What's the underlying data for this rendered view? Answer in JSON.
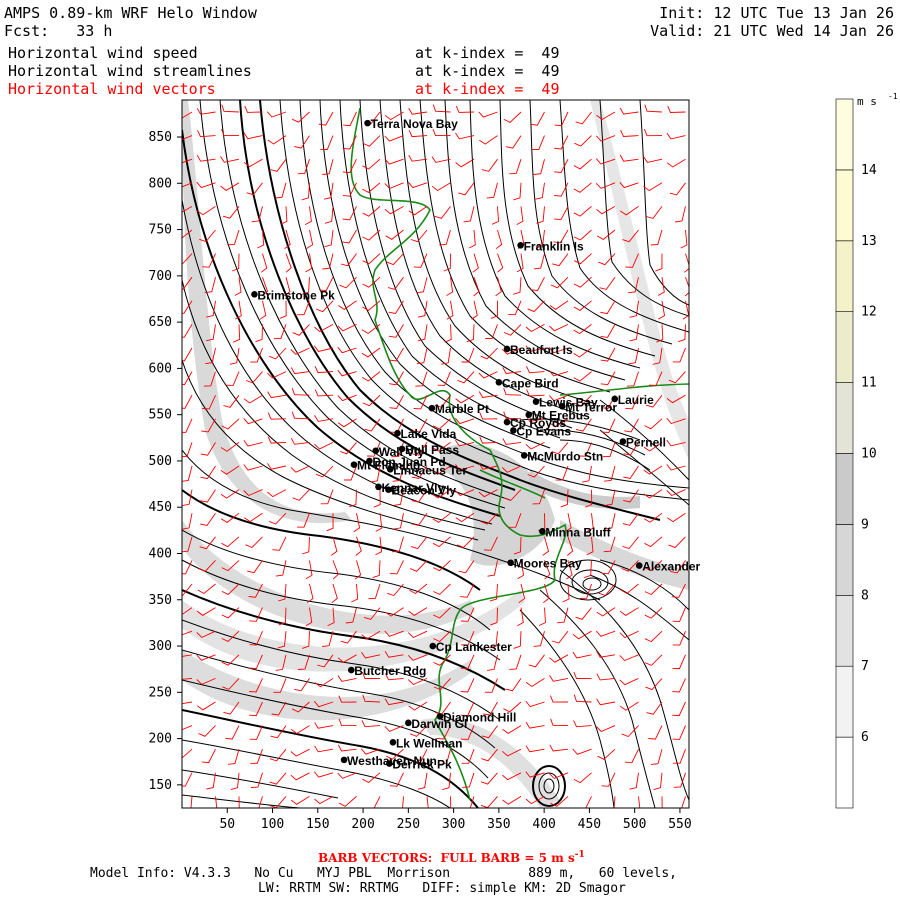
{
  "header": {
    "title": "AMPS 0.89-km WRF Helo Window",
    "fcst": "Fcst:   33 h",
    "init": "Init: 12 UTC Tue 13 Jan 26",
    "valid": "Valid: 21 UTC Wed 14 Jan 26",
    "fields": [
      {
        "name": "Horizontal wind speed",
        "level": "at k-index =  49",
        "color": "#000000"
      },
      {
        "name": "Horizontal wind streamlines",
        "level": "at k-index =  49",
        "color": "#000000"
      },
      {
        "name": "Horizontal wind vectors",
        "level": "at k-index =  49",
        "color": "#ff0000"
      }
    ]
  },
  "map": {
    "x_ticks": [
      50,
      100,
      150,
      200,
      250,
      300,
      350,
      400,
      450,
      500,
      550
    ],
    "y_ticks": [
      150,
      200,
      250,
      300,
      350,
      400,
      450,
      500,
      550,
      600,
      650,
      700,
      750,
      800,
      850
    ],
    "x_range": [
      0,
      560
    ],
    "y_range": [
      125,
      890
    ],
    "coast_color": "#1a8a1a",
    "barb_color": "#ff0000",
    "places": [
      {
        "name": "Terra Nova Bay",
        "x": 205,
        "y": 865
      },
      {
        "name": "Franklin Is",
        "x": 374,
        "y": 733
      },
      {
        "name": "Brimstone Pk",
        "x": 80,
        "y": 680
      },
      {
        "name": "Beaufort Is",
        "x": 359,
        "y": 621
      },
      {
        "name": "Cape Bird",
        "x": 350,
        "y": 585
      },
      {
        "name": "Lewis Bay",
        "x": 391,
        "y": 564
      },
      {
        "name": "Laurie",
        "x": 478,
        "y": 567
      },
      {
        "name": "Marble Pt",
        "x": 276,
        "y": 557
      },
      {
        "name": "Mt Terror",
        "x": 420,
        "y": 559
      },
      {
        "name": "Cp Royds",
        "x": 359,
        "y": 542
      },
      {
        "name": "Mt Erebus",
        "x": 383,
        "y": 550
      },
      {
        "name": "Lake Vida",
        "x": 238,
        "y": 530
      },
      {
        "name": "Cp Evans",
        "x": 366,
        "y": 533
      },
      {
        "name": "Pernell",
        "x": 487,
        "y": 521
      },
      {
        "name": "Wall Vly",
        "x": 214,
        "y": 511
      },
      {
        "name": "Bull Pass",
        "x": 243,
        "y": 513
      },
      {
        "name": "McMurdo Stn",
        "x": 378,
        "y": 506
      },
      {
        "name": "Don Juan Pd",
        "x": 207,
        "y": 500
      },
      {
        "name": "Mt Fleming",
        "x": 190,
        "y": 496
      },
      {
        "name": "Linnaeus Ter",
        "x": 230,
        "y": 491
      },
      {
        "name": "Kennar Vly",
        "x": 217,
        "y": 472
      },
      {
        "name": "Beacon Vly",
        "x": 228,
        "y": 469
      },
      {
        "name": "Minna Bluff",
        "x": 398,
        "y": 424
      },
      {
        "name": "Moores Bay",
        "x": 363,
        "y": 390
      },
      {
        "name": "Alexander",
        "x": 505,
        "y": 387
      },
      {
        "name": "Cp Lankester",
        "x": 277,
        "y": 300
      },
      {
        "name": "Butcher Rdg",
        "x": 187,
        "y": 274
      },
      {
        "name": "Darwin Gl",
        "x": 250,
        "y": 217
      },
      {
        "name": "Diamond Hill",
        "x": 285,
        "y": 224
      },
      {
        "name": "Lk Wellman",
        "x": 233,
        "y": 196
      },
      {
        "name": "Westhaven Nun",
        "x": 179,
        "y": 177
      },
      {
        "name": "Derrick Pk",
        "x": 229,
        "y": 173
      }
    ]
  },
  "colorbar": {
    "unit": "m s",
    "unit_exp": "-1",
    "levels": [
      6,
      7,
      8,
      9,
      10,
      11,
      12,
      13,
      14
    ],
    "colors": [
      "#ffffff",
      "#f2f2f2",
      "#e2e2e2",
      "#d6d6d6",
      "#cacaca",
      "#e4e4d6",
      "#ececcc",
      "#f4f2c8",
      "#fdfbd2",
      "#fffde0"
    ]
  },
  "footer": {
    "barb_note": "BARB VECTORS:  FULL BARB = 5 m s",
    "barb_exp": "-1",
    "model_line": "Model Info: V4.3.3   No Cu   MYJ PBL  Morrison          889 m,   60 levels,",
    "physics_line": "LW: RRTM SW: RRTMG   DIFF: simple KM: 2D Smagor"
  }
}
